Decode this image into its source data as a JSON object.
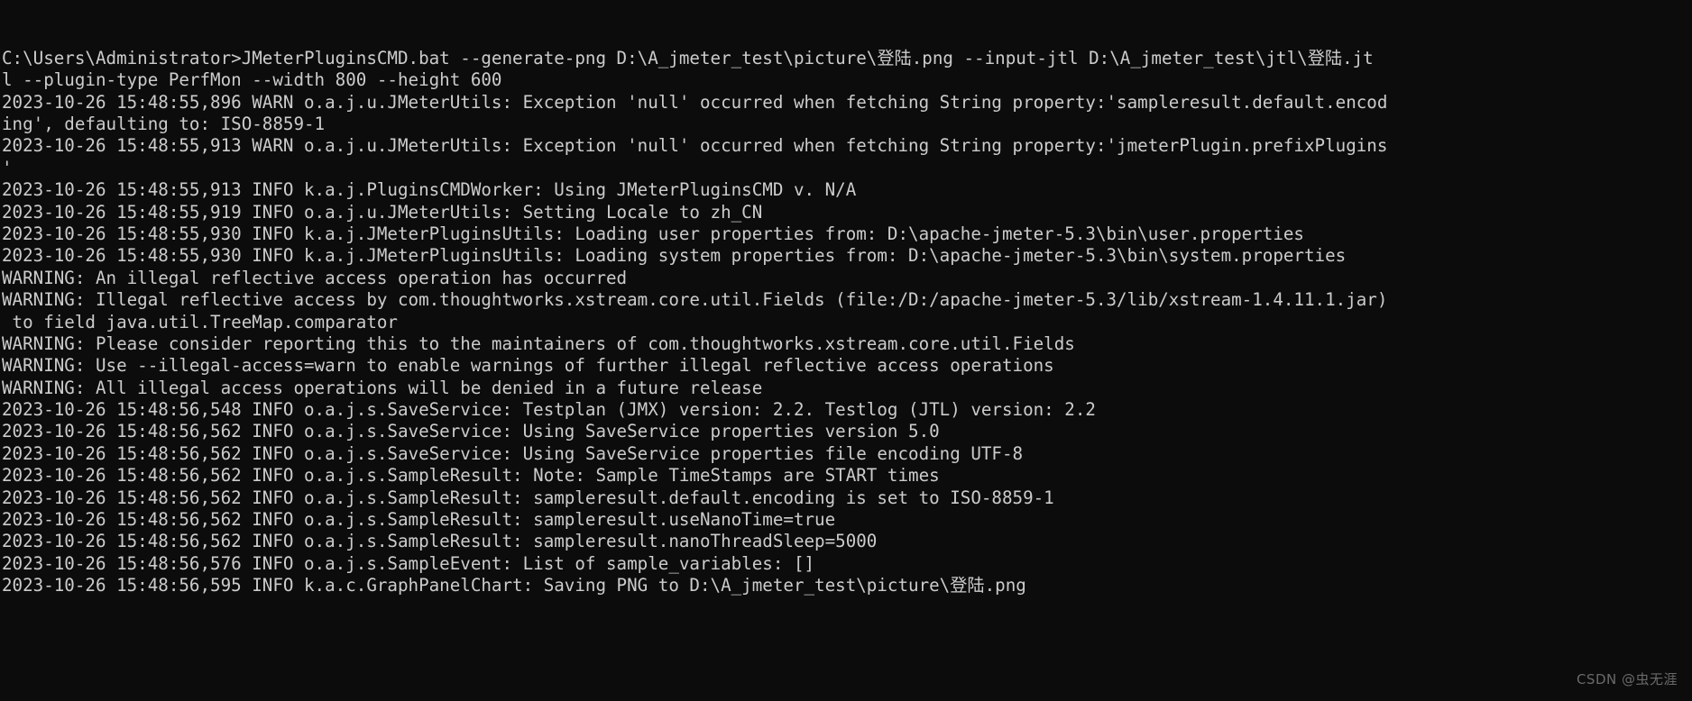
{
  "window": {
    "type": "windows-command-prompt",
    "background_color": "#0c0c0c",
    "text_color": "#cccccc"
  },
  "terminal": {
    "lines": [
      "C:\\Users\\Administrator>JMeterPluginsCMD.bat --generate-png D:\\A_jmeter_test\\picture\\登陆.png --input-jtl D:\\A_jmeter_test\\jtl\\登陆.jt",
      "l --plugin-type PerfMon --width 800 --height 600",
      "2023-10-26 15:48:55,896 WARN o.a.j.u.JMeterUtils: Exception 'null' occurred when fetching String property:'sampleresult.default.encod",
      "ing', defaulting to: ISO-8859-1",
      "2023-10-26 15:48:55,913 WARN o.a.j.u.JMeterUtils: Exception 'null' occurred when fetching String property:'jmeterPlugin.prefixPlugins",
      "'",
      "2023-10-26 15:48:55,913 INFO k.a.j.PluginsCMDWorker: Using JMeterPluginsCMD v. N/A",
      "2023-10-26 15:48:55,919 INFO o.a.j.u.JMeterUtils: Setting Locale to zh_CN",
      "2023-10-26 15:48:55,930 INFO k.a.j.JMeterPluginsUtils: Loading user properties from: D:\\apache-jmeter-5.3\\bin\\user.properties",
      "2023-10-26 15:48:55,930 INFO k.a.j.JMeterPluginsUtils: Loading system properties from: D:\\apache-jmeter-5.3\\bin\\system.properties",
      "WARNING: An illegal reflective access operation has occurred",
      "WARNING: Illegal reflective access by com.thoughtworks.xstream.core.util.Fields (file:/D:/apache-jmeter-5.3/lib/xstream-1.4.11.1.jar)",
      " to field java.util.TreeMap.comparator",
      "WARNING: Please consider reporting this to the maintainers of com.thoughtworks.xstream.core.util.Fields",
      "WARNING: Use --illegal-access=warn to enable warnings of further illegal reflective access operations",
      "WARNING: All illegal access operations will be denied in a future release",
      "2023-10-26 15:48:56,548 INFO o.a.j.s.SaveService: Testplan (JMX) version: 2.2. Testlog (JTL) version: 2.2",
      "2023-10-26 15:48:56,562 INFO o.a.j.s.SaveService: Using SaveService properties version 5.0",
      "2023-10-26 15:48:56,562 INFO o.a.j.s.SaveService: Using SaveService properties file encoding UTF-8",
      "2023-10-26 15:48:56,562 INFO o.a.j.s.SampleResult: Note: Sample TimeStamps are START times",
      "2023-10-26 15:48:56,562 INFO o.a.j.s.SampleResult: sampleresult.default.encoding is set to ISO-8859-1",
      "2023-10-26 15:48:56,562 INFO o.a.j.s.SampleResult: sampleresult.useNanoTime=true",
      "2023-10-26 15:48:56,562 INFO o.a.j.s.SampleResult: sampleresult.nanoThreadSleep=5000",
      "2023-10-26 15:48:56,576 INFO o.a.j.s.SampleEvent: List of sample_variables: []",
      "2023-10-26 15:48:56,595 INFO k.a.c.GraphPanelChart: Saving PNG to D:\\A_jmeter_test\\picture\\登陆.png"
    ]
  },
  "watermark": {
    "text": "CSDN @虫无涯"
  }
}
